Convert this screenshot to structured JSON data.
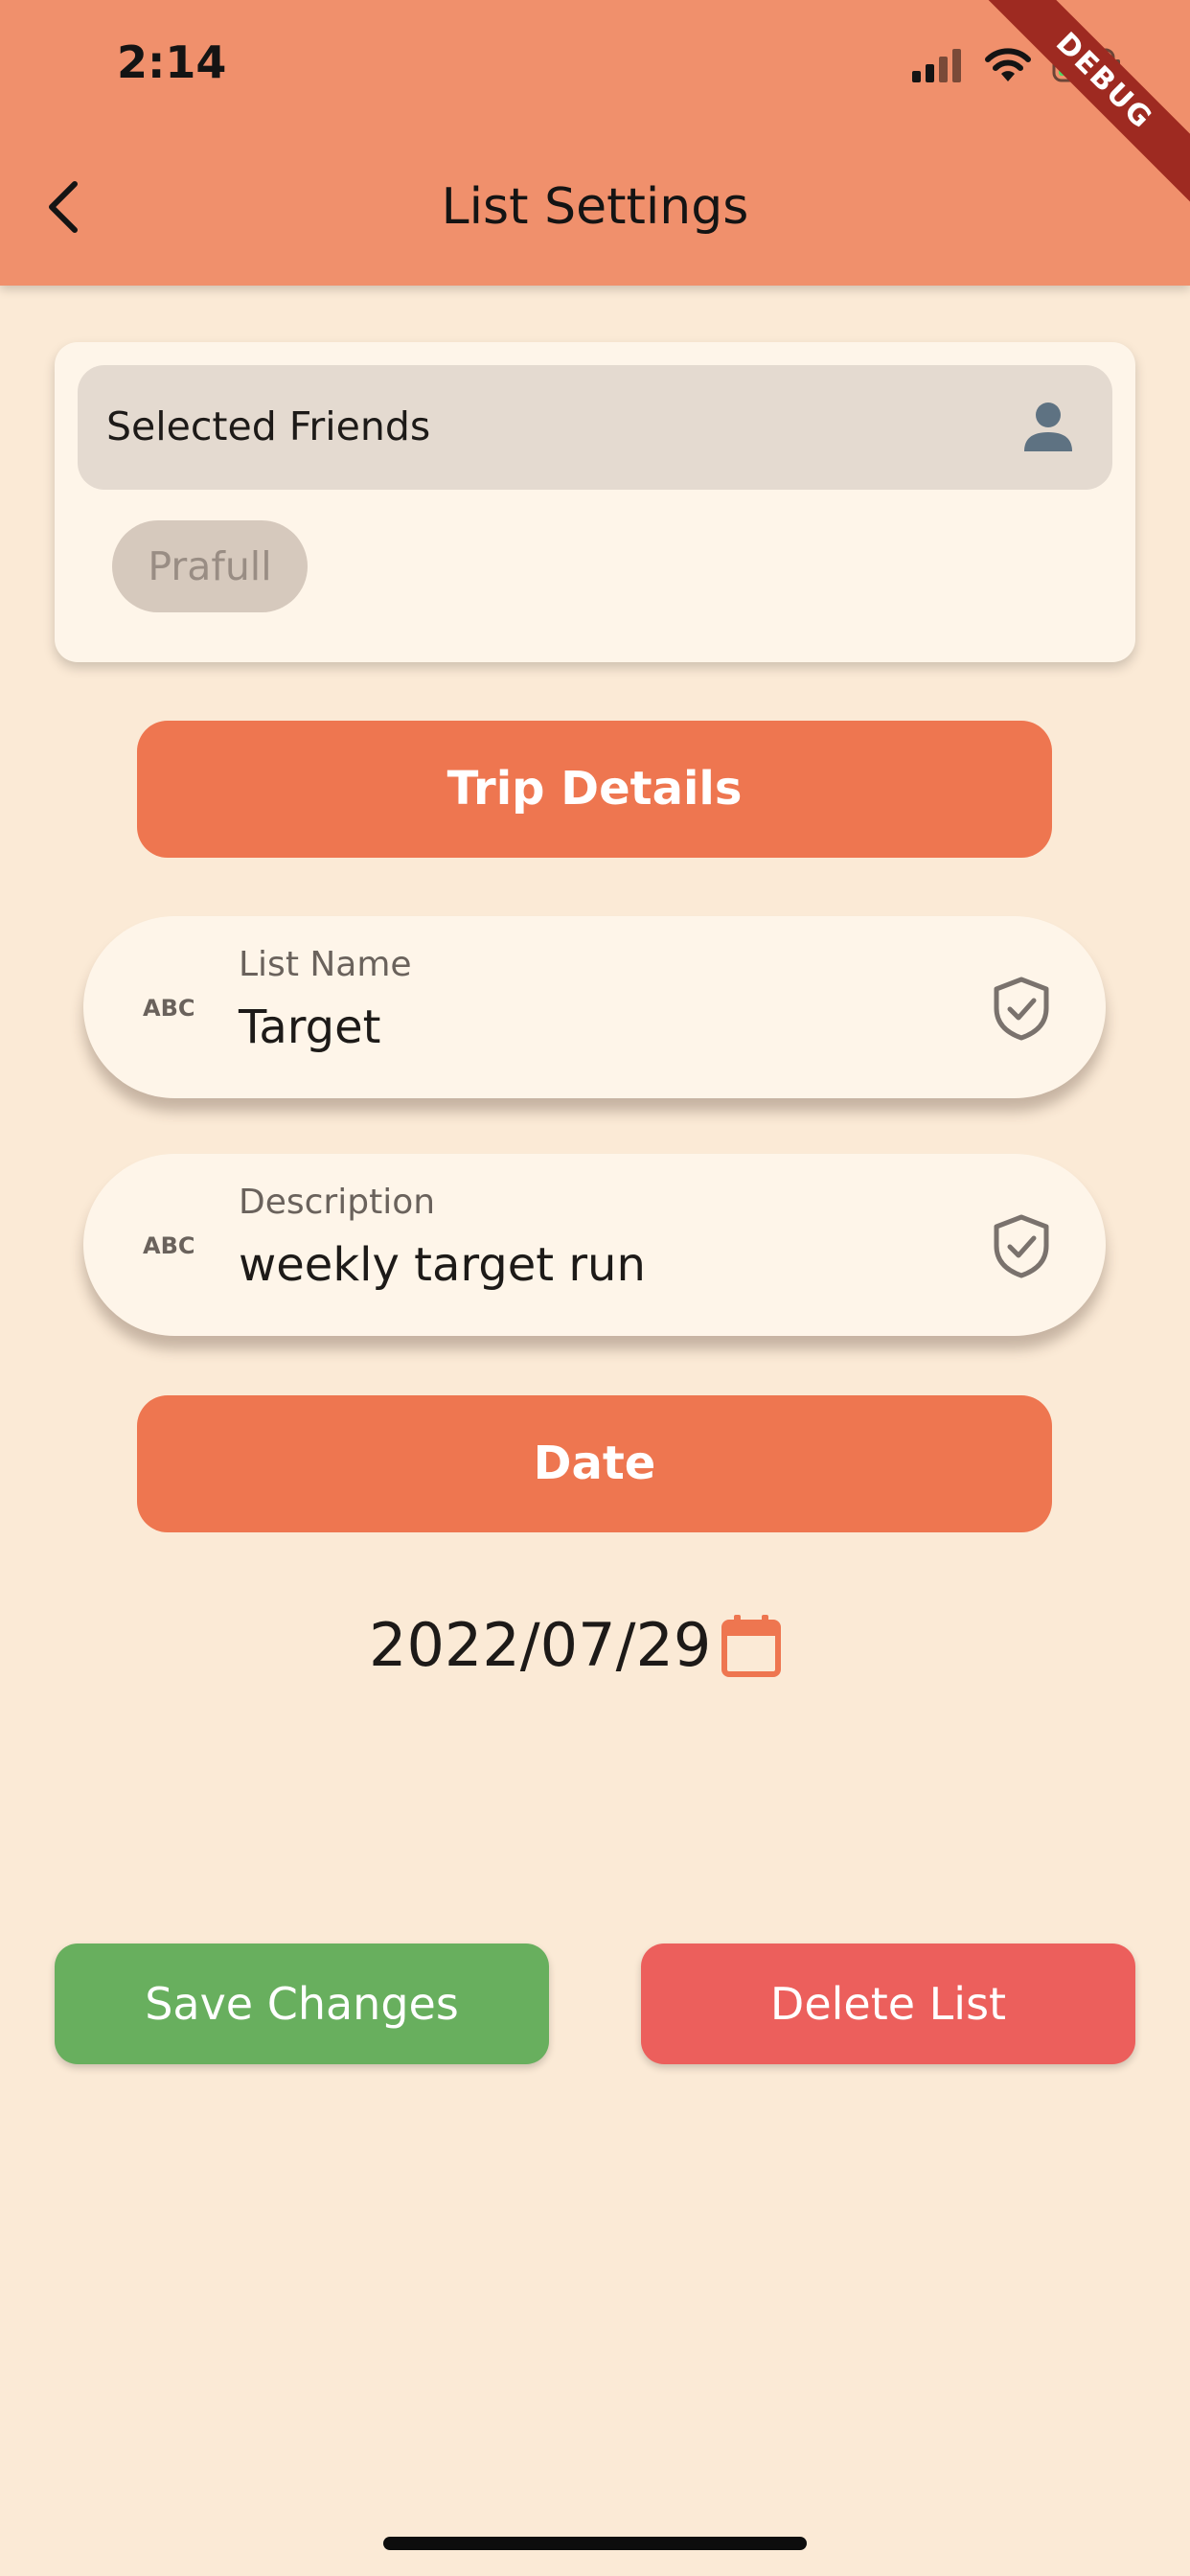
{
  "status_bar": {
    "time": "2:14"
  },
  "debug_banner": "DEBUG",
  "app_bar": {
    "title": "List Settings"
  },
  "friends": {
    "label": "Selected Friends",
    "chips": [
      "Prafull"
    ]
  },
  "sections": {
    "trip_details": "Trip Details",
    "date": "Date"
  },
  "fields": {
    "list_name": {
      "label": "List Name",
      "value": "Target"
    },
    "description": {
      "label": "Description",
      "value": "weekly target run"
    }
  },
  "date_value": "2022/07/29",
  "actions": {
    "save": "Save Changes",
    "delete": "Delete List"
  },
  "colors": {
    "app_bar": "#F0906C",
    "background": "#FBEAD6",
    "accent": "#EE7650",
    "save": "#68AF5E",
    "delete": "#EC5F5C"
  },
  "icons": [
    "back-arrow-icon",
    "person-icon",
    "abc-icon",
    "shield-check-icon",
    "calendar-icon",
    "signal-icon",
    "wifi-icon",
    "battery-icon"
  ]
}
